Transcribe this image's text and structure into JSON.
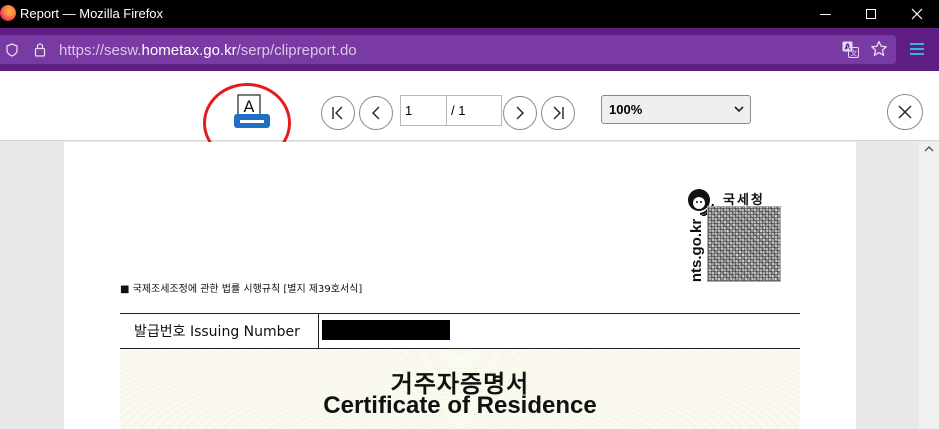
{
  "window": {
    "title": "Report — Mozilla Firefox"
  },
  "urlbar": {
    "url_prefix": "https://sesw.",
    "url_domain": "hometax.go.kr",
    "url_path": "/serp/clipreport.do"
  },
  "toolbar": {
    "print_glyph": "A",
    "current_page": "1",
    "total_pages": "/ 1",
    "zoom": "100%"
  },
  "document": {
    "agency_korean": "국세청",
    "agency_domain": "nts.go.kr",
    "form_reference": "■ 국제조세조정에 관한 법률 시행규칙 [별지 제39호서식]",
    "issuing_number_label": "발급번호 Issuing Number",
    "title_korean": "거주자증명서",
    "title_english": "Certificate of Residence"
  },
  "colors": {
    "urlbar": "#5e1d82",
    "url_field": "#7a3aa3",
    "highlight_circle": "#e11d1d",
    "print_icon": "#1f6fc4"
  }
}
